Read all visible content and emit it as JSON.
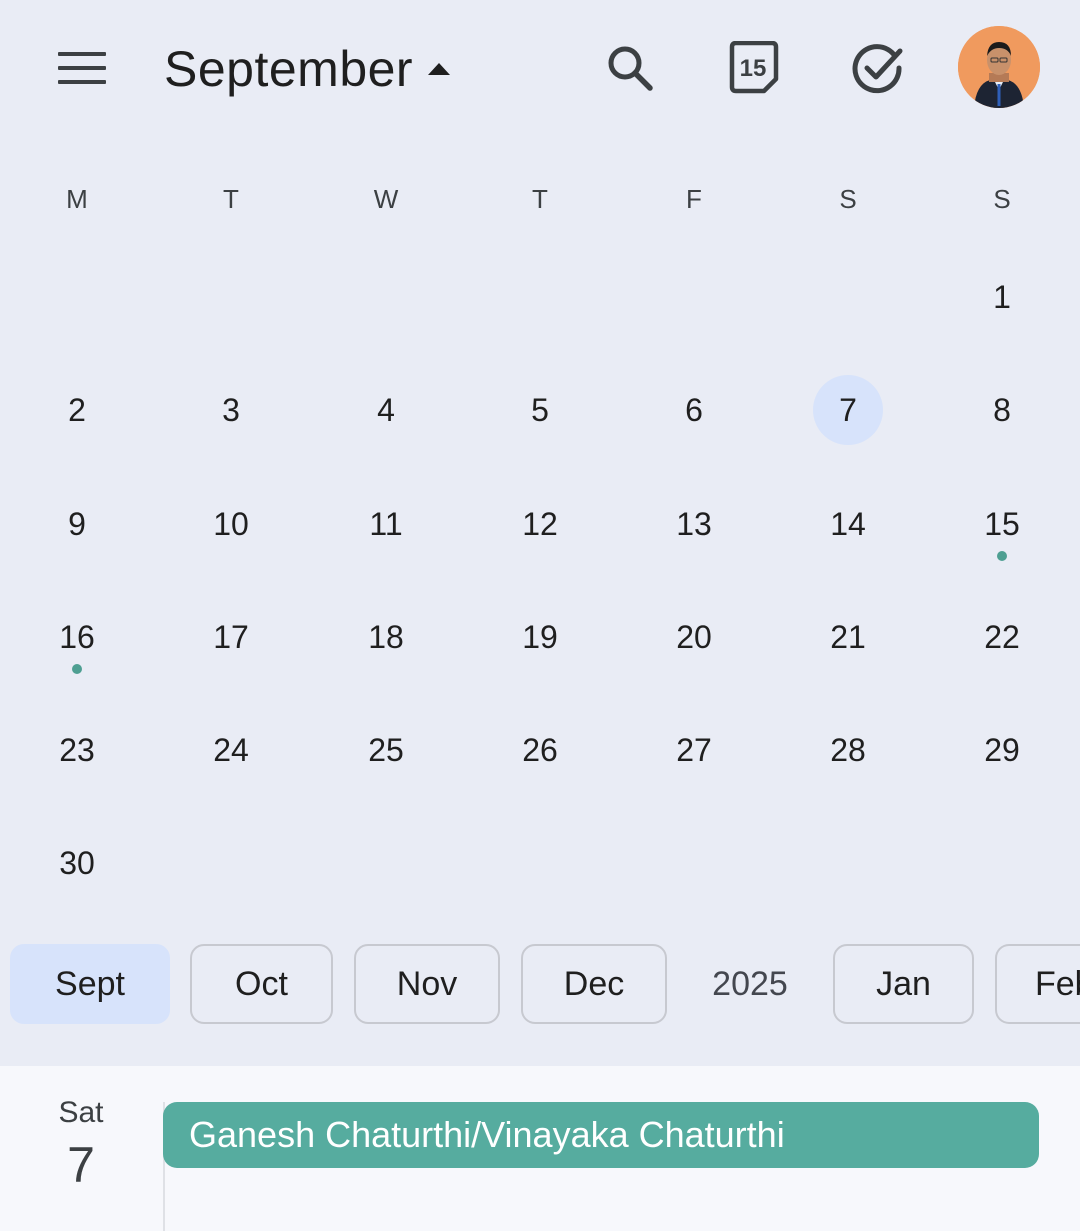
{
  "header": {
    "month_title": "September",
    "today_badge": "15",
    "icons": [
      "menu-icon",
      "caret-up-icon",
      "search-icon",
      "calendar-today-icon",
      "tasks-check-icon",
      "avatar"
    ]
  },
  "weekdays": [
    "M",
    "T",
    "W",
    "T",
    "F",
    "S",
    "S"
  ],
  "days": {
    "d1": "1",
    "d2": "2",
    "d3": "3",
    "d4": "4",
    "d5": "5",
    "d6": "6",
    "d7": "7",
    "d8": "8",
    "d9": "9",
    "d10": "10",
    "d11": "11",
    "d12": "12",
    "d13": "13",
    "d14": "14",
    "d15": "15",
    "d16": "16",
    "d17": "17",
    "d18": "18",
    "d19": "19",
    "d20": "20",
    "d21": "21",
    "d22": "22",
    "d23": "23",
    "d24": "24",
    "d25": "25",
    "d26": "26",
    "d27": "27",
    "d28": "28",
    "d29": "29",
    "d30": "30"
  },
  "selected_day": "7",
  "days_with_events": [
    "15",
    "16"
  ],
  "month_chips": [
    "Sept",
    "Oct",
    "Nov",
    "Dec",
    "Jan",
    "Feb"
  ],
  "year_label": "2025",
  "events_panel": {
    "day_of_week": "Sat",
    "day_number": "7",
    "event_title": "Ganesh Chaturthi/Vinayaka Chaturthi"
  },
  "colors": {
    "background": "#e9ecf5",
    "selected": "#d7e3fb",
    "event": "#56ac9f",
    "dot": "#4e9f92"
  }
}
